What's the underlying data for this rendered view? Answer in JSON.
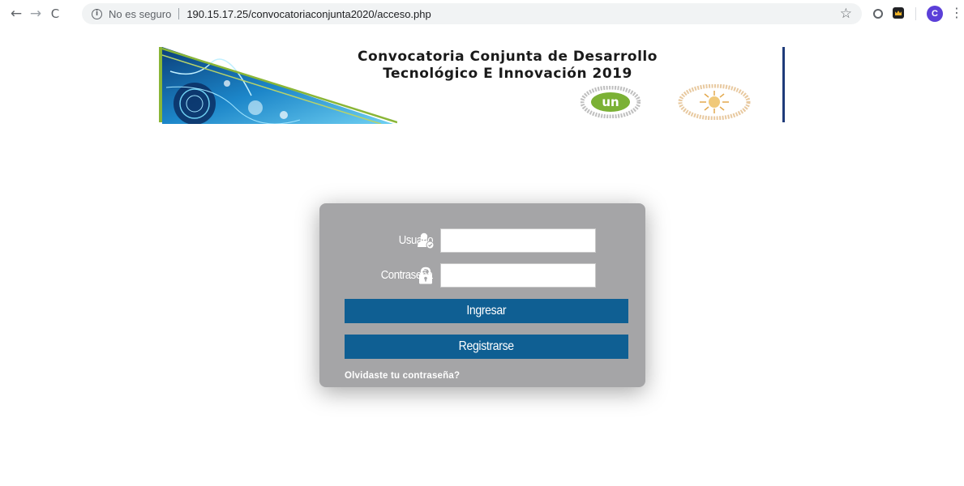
{
  "browser": {
    "security_text": "No es seguro",
    "url": "190.15.17.25/convocatoriaconjunta2020/acceso.php",
    "avatar_letter": "C"
  },
  "banner": {
    "title_line1": "Convocatoria Conjunta de Desarrollo",
    "title_line2": "Tecnológico E Innovación 2019",
    "logo_un_text": "un",
    "logo_un_ring_text": "UNIVERSIDAD NACIONAL DE COLOMBIA",
    "logo_sun_ring_text": "UNIVERSIDAD DE CALDAS",
    "accent_green": "#8ab637",
    "accent_navy": "#1f3b7a"
  },
  "login": {
    "user_label": "Usuario",
    "user_value": "",
    "password_label": "Contraseña",
    "password_value": "",
    "login_button": "Ingresar",
    "register_button": "Registrarse",
    "forgot_link": "Olvidaste tu contraseña?",
    "card_color": "#a5a5a7",
    "button_color": "#0f5f93"
  }
}
